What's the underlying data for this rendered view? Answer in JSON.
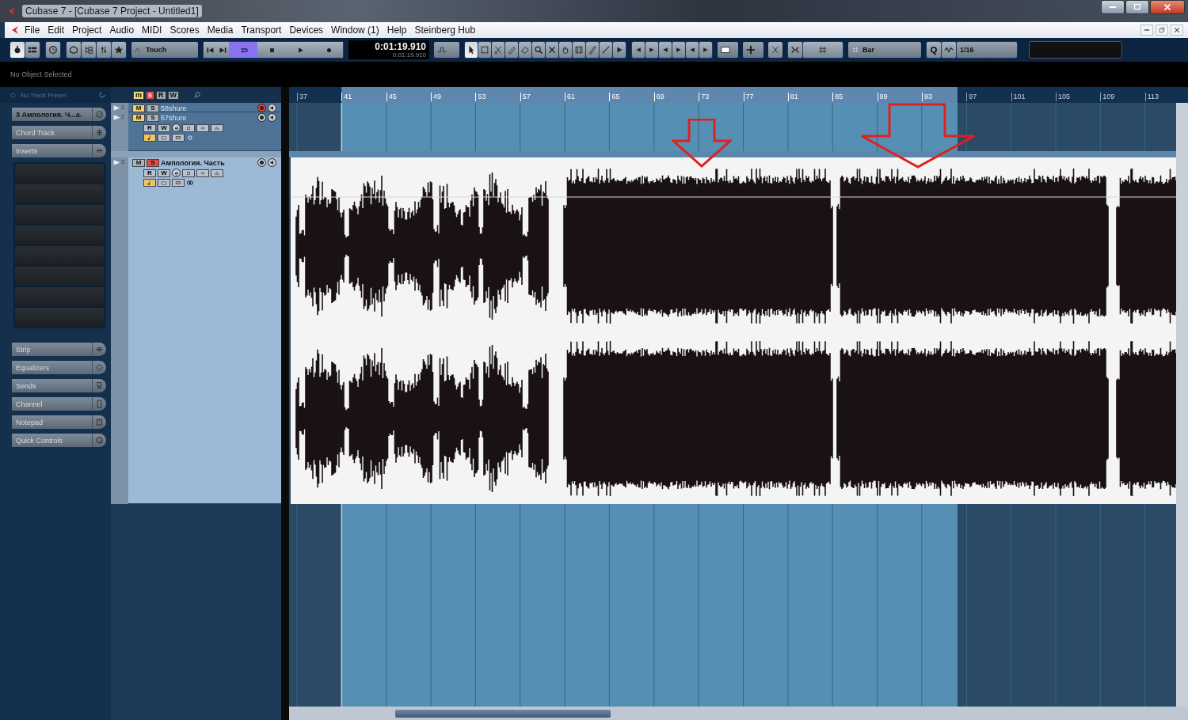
{
  "window": {
    "title": "Cubase 7 - [Cubase 7 Project - Untitled1]"
  },
  "menu": [
    "File",
    "Edit",
    "Project",
    "Audio",
    "MIDI",
    "Scores",
    "Media",
    "Transport",
    "Devices",
    "Window (1)",
    "Help",
    "Steinberg Hub"
  ],
  "toolbar": {
    "automation_mode": "Touch",
    "transport": [
      {
        "kind": "go-to-start",
        "on": false
      },
      {
        "kind": "go-to-end",
        "on": false
      },
      {
        "kind": "cycle",
        "on": true
      },
      {
        "kind": "stop",
        "on": false
      },
      {
        "kind": "play",
        "on": false
      },
      {
        "kind": "record",
        "on": false
      }
    ],
    "time_primary": "0:01:19.910",
    "time_secondary": "0:01:19.910",
    "tools": [
      {
        "kind": "object-select",
        "selected": true
      },
      {
        "kind": "range",
        "selected": false
      },
      {
        "kind": "split",
        "selected": false
      },
      {
        "kind": "glue",
        "selected": false
      },
      {
        "kind": "erase",
        "selected": false
      },
      {
        "kind": "zoom",
        "selected": false
      },
      {
        "kind": "mute",
        "selected": false
      },
      {
        "kind": "hand",
        "selected": false
      },
      {
        "kind": "warp",
        "selected": false
      },
      {
        "kind": "draw",
        "selected": false
      },
      {
        "kind": "line",
        "selected": false
      },
      {
        "kind": "play",
        "selected": false
      }
    ],
    "grid_type": "Bar",
    "quantize_icon": "Q",
    "quantize": "1/16"
  },
  "info_line": "No Object Selected",
  "inspector": {
    "preset": "No Track Preset",
    "track_number": "3",
    "track_name": "Ампология. Ч...а.",
    "sections": [
      {
        "label": "Chord Track",
        "kind": "chord"
      },
      {
        "label": "Inserts",
        "kind": "inserts"
      },
      {
        "label": "Strip",
        "kind": "strip"
      },
      {
        "label": "Equalizers",
        "kind": "eq"
      },
      {
        "label": "Sends",
        "kind": "sends"
      },
      {
        "label": "Channel",
        "kind": "channel"
      },
      {
        "label": "Notepad",
        "kind": "notepad"
      },
      {
        "label": "Quick Controls",
        "kind": "quick"
      }
    ]
  },
  "track_list": {
    "header_buttons": [
      {
        "label": "m",
        "on": true
      },
      {
        "label": "s",
        "on": true
      },
      {
        "label": "R",
        "on": false
      },
      {
        "label": "W",
        "on": false
      }
    ],
    "tracks": [
      {
        "number": "1",
        "name": "58shure",
        "mute_label": "M",
        "solo_label": "S",
        "mute": true,
        "solo": false,
        "record_enabled": true,
        "selected": false,
        "expanded": false
      },
      {
        "number": "2",
        "name": "57shure",
        "mute_label": "M",
        "solo_label": "S",
        "mute": true,
        "solo": false,
        "record_enabled": false,
        "selected": false,
        "expanded": true,
        "read_label": "R",
        "write_label": "W"
      },
      {
        "number": "3",
        "name": "Ампология. Часть",
        "mute_label": "M",
        "solo_label": "S",
        "mute": false,
        "solo": true,
        "record_enabled": false,
        "selected": true,
        "expanded": true,
        "read_label": "R",
        "write_label": "W"
      }
    ]
  },
  "ruler": [
    {
      "label": "37",
      "in_cycle": false
    },
    {
      "label": "41",
      "in_cycle": true
    },
    {
      "label": "45",
      "in_cycle": true
    },
    {
      "label": "49",
      "in_cycle": true
    },
    {
      "label": "53",
      "in_cycle": true
    },
    {
      "label": "57",
      "in_cycle": true
    },
    {
      "label": "61",
      "in_cycle": true
    },
    {
      "label": "65",
      "in_cycle": true
    },
    {
      "label": "69",
      "in_cycle": true
    },
    {
      "label": "73",
      "in_cycle": true
    },
    {
      "label": "77",
      "in_cycle": true
    },
    {
      "label": "81",
      "in_cycle": true
    },
    {
      "label": "85",
      "in_cycle": true
    },
    {
      "label": "89",
      "in_cycle": true
    },
    {
      "label": "93",
      "in_cycle": true
    },
    {
      "label": "97",
      "in_cycle": false
    },
    {
      "label": "101",
      "in_cycle": false
    },
    {
      "label": "105",
      "in_cycle": false
    },
    {
      "label": "109",
      "in_cycle": false
    },
    {
      "label": "113",
      "in_cycle": false
    }
  ]
}
